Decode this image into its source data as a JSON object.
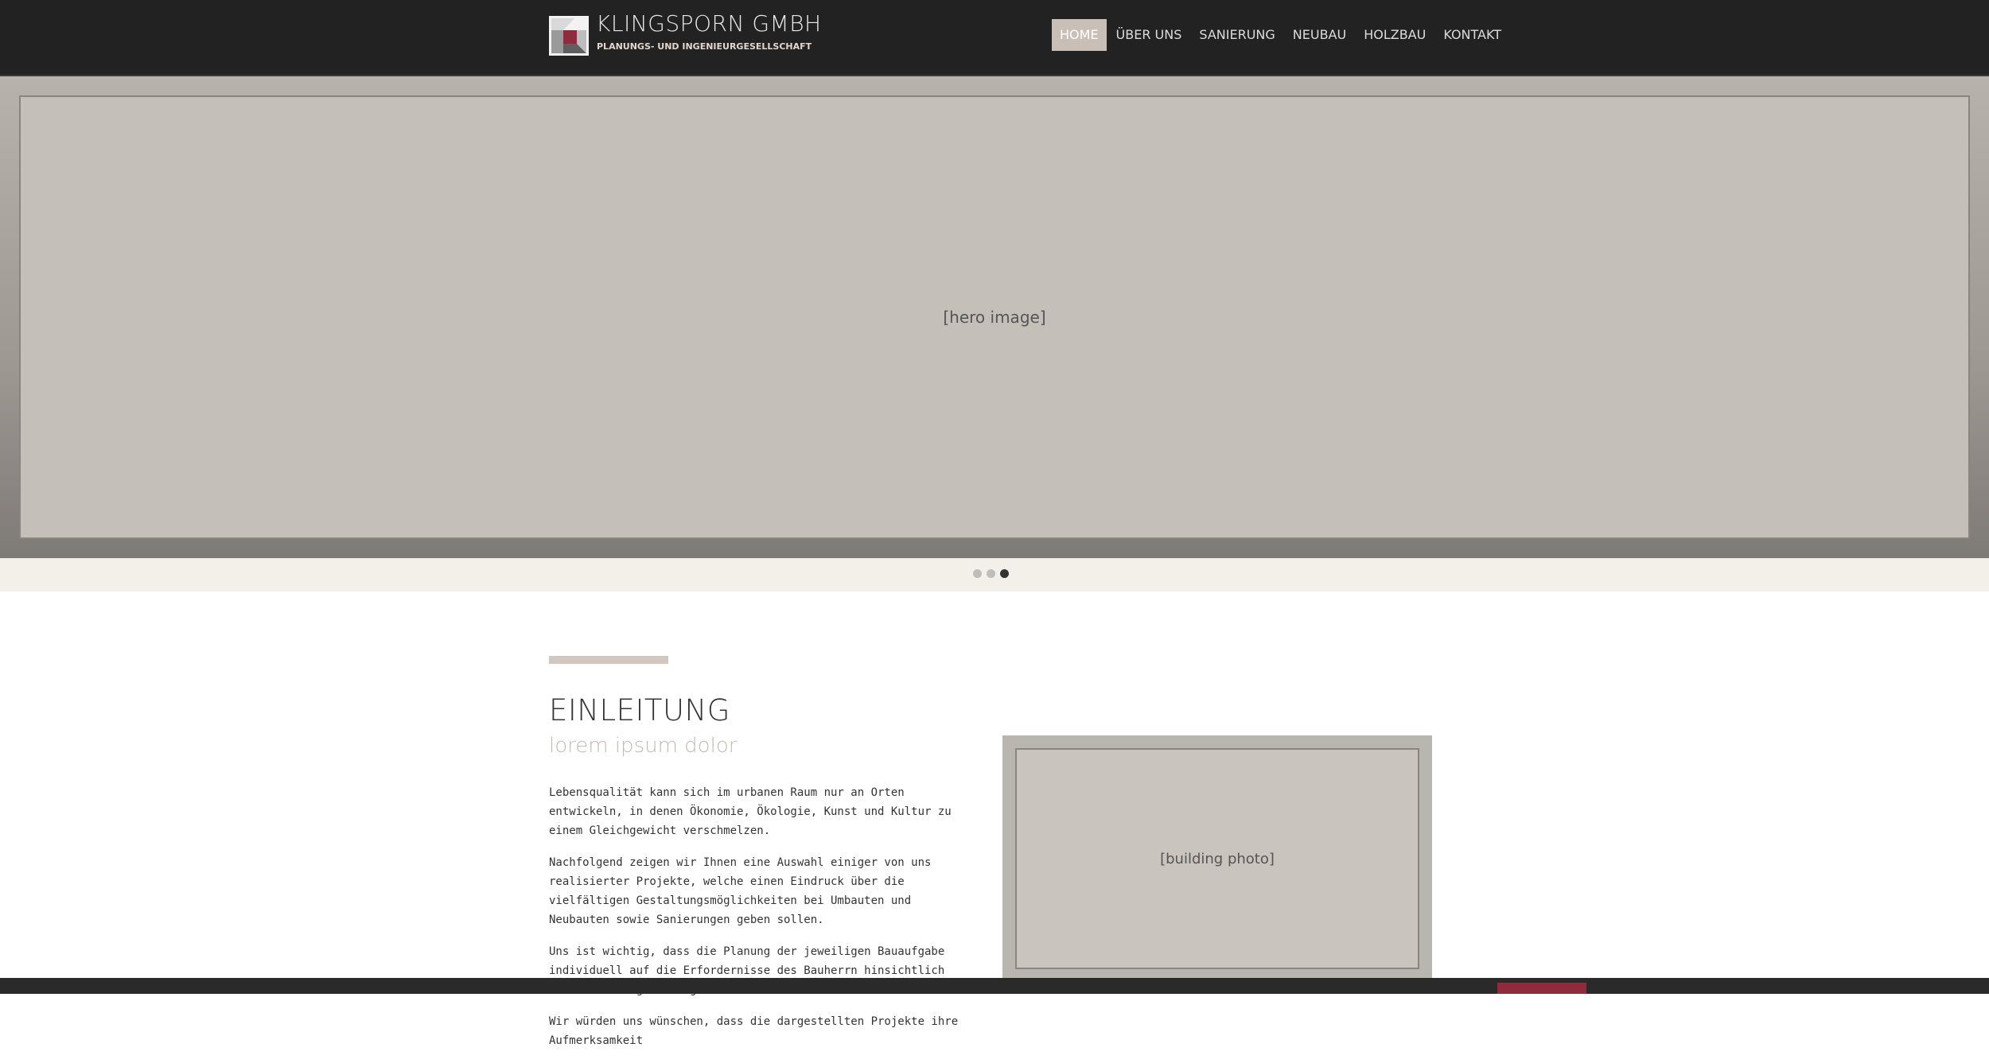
{
  "header": {
    "brand_name": "KLINGSPORN GMBH",
    "brand_sub": "PLANUNGS- UND INGENIEURGESELLSCHAFT",
    "nav": [
      {
        "label": "HOME",
        "active": true
      },
      {
        "label": "ÜBER UNS",
        "active": false
      },
      {
        "label": "SANIERUNG",
        "active": false
      },
      {
        "label": "NEUBAU",
        "active": false
      },
      {
        "label": "HOLZBAU",
        "active": false
      },
      {
        "label": "KONTAKT",
        "active": false
      }
    ]
  },
  "hero": {
    "image_placeholder": "[hero image]",
    "slider_dots": 3,
    "active_slide": 3
  },
  "content": {
    "title": "EINLEITUNG",
    "subtitle": "lorem ipsum dolor",
    "paragraphs": [
      "Lebensqualität kann sich im urbanen Raum nur an Orten entwickeln, in denen Ökonomie, Ökologie, Kunst und Kultur zu einem Gleichgewicht verschmelzen.",
      "Nachfolgend zeigen wir Ihnen eine Auswahl einiger von uns realisierter Projekte, welche einen Eindruck über die vielfältigen Gestaltungsmöglichkeiten bei Umbauten und Neubauten sowie Sanierungen geben sollen.",
      "Uns ist wichtig, dass die Planung der jeweiligen Bauaufgabe individuell auf die Erfordernisse des Bauherrn hinsichtlich seiner Bauaufgabe eingeht.",
      "Wir würden uns wünschen, dass die dargestellten Projekte ihre Aufmerksamkeit"
    ],
    "side_image_placeholder": "[building photo]"
  },
  "colors": {
    "header_bg": "#222222",
    "nav_active_bg": "#c9bfb7",
    "brand_sub": "#e2d6cd",
    "accent_bar": "#d2c8c0",
    "accent_red": "#8e2b3c"
  }
}
